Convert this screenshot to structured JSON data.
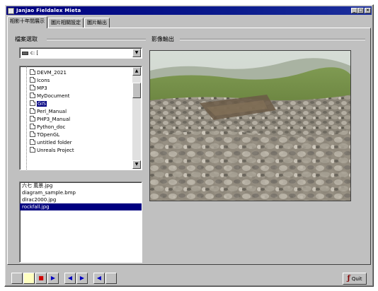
{
  "window": {
    "title": "Janjao Fieldalex Mieta",
    "buttons": {
      "minimize": "_",
      "maximize": "□",
      "close": "×"
    }
  },
  "tabs": [
    "相影十年間展示",
    "圖片相關設定",
    "圖片輸出"
  ],
  "left_panel": {
    "label": "檔案選取",
    "drive": {
      "value": "c: [",
      "arrow": "▼"
    },
    "directories": [
      {
        "name": "DEVM_2021",
        "selected": false
      },
      {
        "name": "Icons",
        "selected": false
      },
      {
        "name": "MP3",
        "selected": false
      },
      {
        "name": "MyDocument",
        "selected": false
      },
      {
        "name": "GIS",
        "selected": true
      },
      {
        "name": "Perl_Manual",
        "selected": false
      },
      {
        "name": "PHP3_Manual",
        "selected": false
      },
      {
        "name": "Python_doc",
        "selected": false
      },
      {
        "name": "TOpenGL",
        "selected": false
      },
      {
        "name": "untitled folder",
        "selected": false
      },
      {
        "name": "Unreals Project",
        "selected": false
      }
    ],
    "scroll": {
      "up": "▲",
      "down": "▼"
    },
    "files": [
      {
        "name": "六七 風景.jpg",
        "selected": false
      },
      {
        "name": "diagram_sample.bmp",
        "selected": false
      },
      {
        "name": "dlrac2000.jpg",
        "selected": false
      },
      {
        "name": "rockfall.jpg",
        "selected": true
      }
    ]
  },
  "right_panel": {
    "label": "影像輸出"
  },
  "playback": {
    "buttons": [
      {
        "icon": "blank-icon",
        "glyph": "",
        "color": "#c0c0c0"
      },
      {
        "icon": "note-icon",
        "glyph": "",
        "color": "#ffffc0"
      },
      {
        "icon": "stop-icon",
        "glyph": "■",
        "color": "#d00000"
      },
      {
        "icon": "play-icon",
        "glyph": "▶",
        "color": "#0000c0"
      },
      {
        "icon": "prev-icon",
        "glyph": "◀",
        "color": "#0000c0"
      },
      {
        "icon": "next-icon",
        "glyph": "▶",
        "color": "#0000c0"
      },
      {
        "icon": "rewind-icon",
        "glyph": "◀",
        "color": "#0000c0"
      },
      {
        "icon": "blank-icon",
        "glyph": "",
        "color": "#c0c0c0"
      }
    ]
  },
  "close_button": {
    "glyph": "ƒ",
    "label": "Quit"
  }
}
